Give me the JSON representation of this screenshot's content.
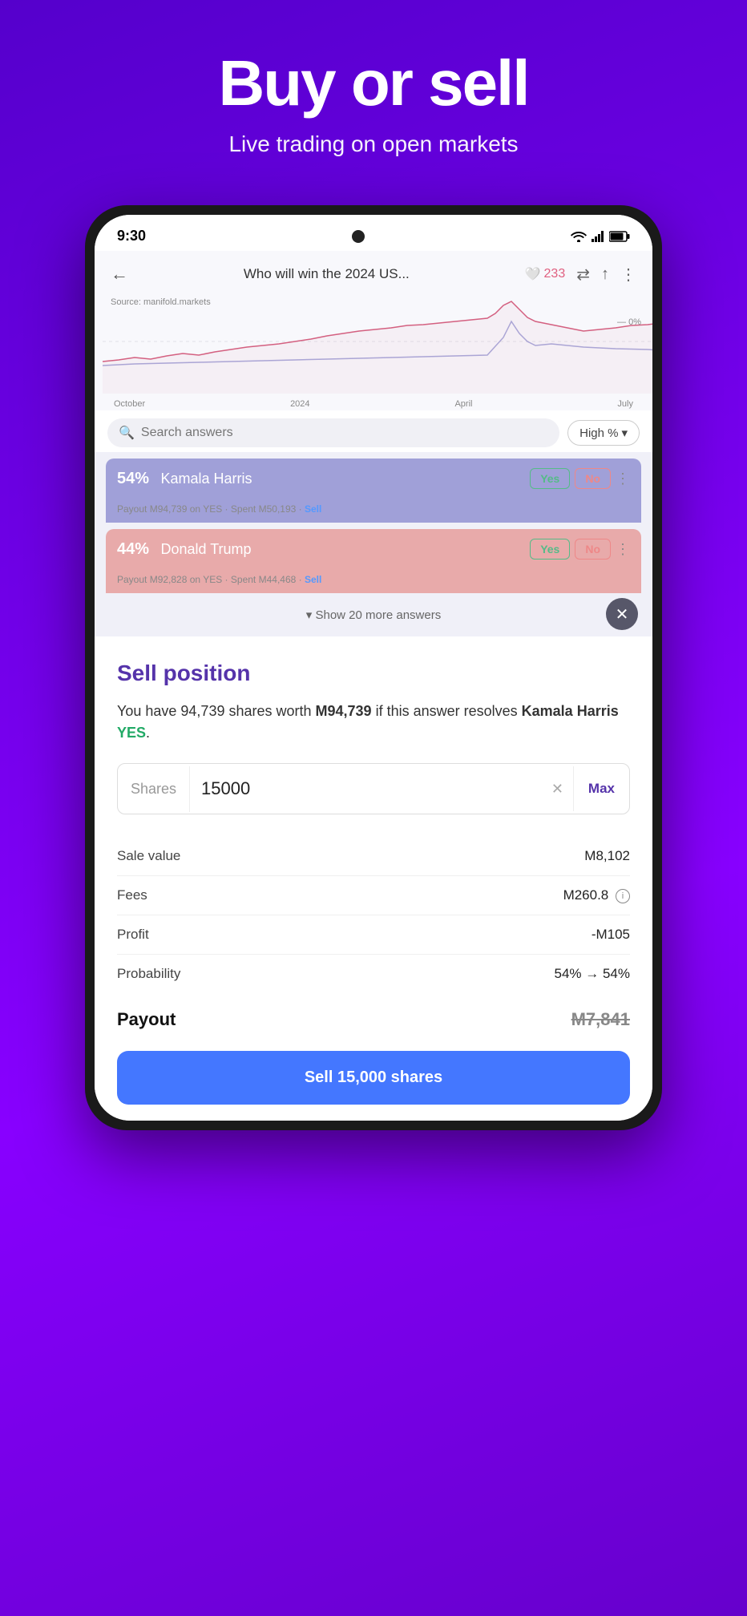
{
  "hero": {
    "title": "Buy or sell",
    "subtitle": "Live trading on open markets"
  },
  "statusBar": {
    "time": "9:30",
    "cameraAlt": "front camera"
  },
  "chartSection": {
    "backLabel": "←",
    "title": "Who will win the 2024 US...",
    "heartCount": "233",
    "zeroLabel": "— 0%",
    "sourceLabel": "Source: manifold.markets",
    "xLabels": [
      "October",
      "2024",
      "April",
      "July"
    ]
  },
  "searchSection": {
    "placeholder": "Search answers",
    "filterLabel": "High %",
    "filterIcon": "▾"
  },
  "answers": [
    {
      "id": "kamala",
      "pct": "54%",
      "name": "Kamala Harris",
      "colorClass": "answer-bar-kamala",
      "payout": "Payout",
      "payoutValue": "M94,739",
      "payoutOn": "on YES",
      "spent": "Spent",
      "spentValue": "M50,193",
      "sellLabel": "Sell"
    },
    {
      "id": "trump",
      "pct": "44%",
      "name": "Donald Trump",
      "colorClass": "answer-bar-trump",
      "payout": "Payout",
      "payoutValue": "M92,828",
      "payoutOn": "on YES",
      "spent": "Spent",
      "spentValue": "M44,468",
      "sellLabel": "Sell"
    }
  ],
  "showMoreLabel": "▾ Show 20 more answers",
  "sellSection": {
    "title": "Sell position",
    "description1": "You have 94,739 shares worth ",
    "descriptionMana": "M94,739",
    "description2": " if this answer resolves ",
    "answerName": "Kamala Harris",
    "resolveLabel": "YES",
    "shares": {
      "label": "Shares",
      "value": "15000",
      "maxLabel": "Max"
    },
    "summaryRows": [
      {
        "label": "Sale value",
        "value": "M8,102",
        "strikethrough": false
      },
      {
        "label": "Fees",
        "value": "M260.8",
        "hasInfo": true,
        "strikethrough": false
      },
      {
        "label": "Profit",
        "value": "-M105",
        "strikethrough": false
      },
      {
        "label": "Probability",
        "value": "54% → 54%",
        "strikethrough": false
      }
    ],
    "payout": {
      "label": "Payout",
      "value": "M7,841",
      "strikethrough": true
    },
    "sellButtonLabel": "Sell 15,000 shares"
  }
}
